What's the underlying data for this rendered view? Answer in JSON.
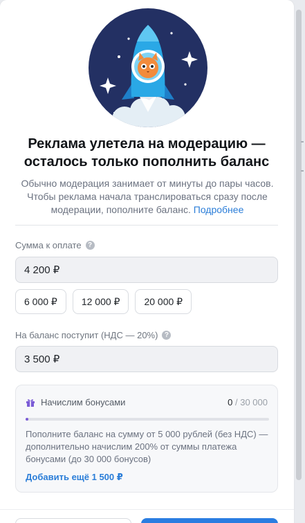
{
  "hero": {
    "illustration": "cat-astronaut-rocket"
  },
  "title": "Реклама улетела на модерацию — осталось только пополнить баланс",
  "subtitle": {
    "text": "Обычно модерация занимает от минуты до пары часов. Чтобы реклама начала транслироваться сразу после модерации, пополните баланс.",
    "link": "Подробнее"
  },
  "payment": {
    "label": "Сумма к оплате",
    "value": "4 200 ₽",
    "presets": [
      "6 000 ₽",
      "12 000 ₽",
      "20 000 ₽"
    ]
  },
  "balance": {
    "label": "На баланс поступит (НДС — 20%)",
    "value": "3 500 ₽"
  },
  "bonus": {
    "title": "Начислим бонусами",
    "current": "0",
    "max": "/ 30 000",
    "progress": 0,
    "text": "Пополните баланс на сумму от 5 000 рублей (без НДС) — дополнительно начислим 200% от суммы платежа бонусами (до 30 000 бонусов)",
    "link": "Добавить ещё 1 500 ₽"
  },
  "colors": {
    "accent": "#2a7dd8",
    "hero_background": "#233063",
    "bonus_progress": "#7b5cd6"
  },
  "icons": {
    "help": "question-icon",
    "bonus": "gift-icon"
  }
}
